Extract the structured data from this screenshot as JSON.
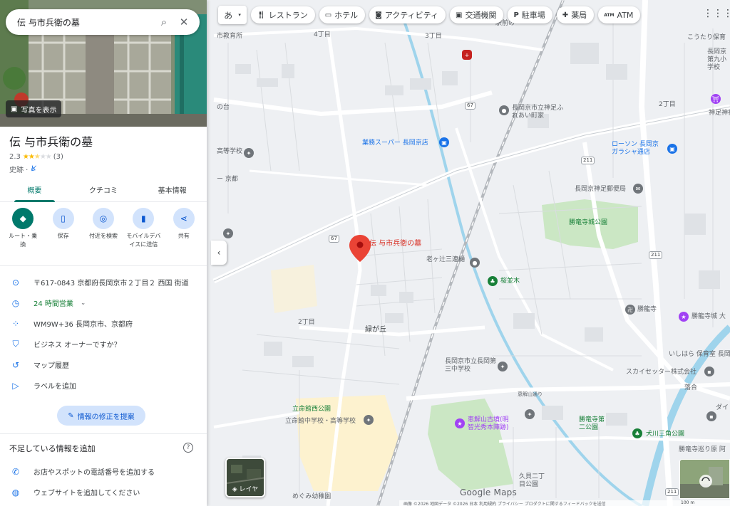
{
  "search": {
    "query": "伝 与市兵衛の墓"
  },
  "place": {
    "photo_button": "写真を表示",
    "title": "伝 与市兵衛の墓",
    "rating": "2.3",
    "review_count": "(3)",
    "category": "史跡 ·"
  },
  "tabs": [
    {
      "label": "概要"
    },
    {
      "label": "クチコミ"
    },
    {
      "label": "基本情報"
    }
  ],
  "actions": [
    {
      "label": "ルート・乗換",
      "icon": "directions-icon"
    },
    {
      "label": "保存",
      "icon": "bookmark-icon"
    },
    {
      "label": "付近を検索",
      "icon": "nearby-icon"
    },
    {
      "label": "モバイルデバイスに送信",
      "icon": "send-to-phone-icon"
    },
    {
      "label": "共有",
      "icon": "share-icon"
    }
  ],
  "info": {
    "address": "〒617-0843 京都府長岡京市２丁目２ 西国 街道",
    "hours": "24 時間営業",
    "plus_code": "WM9W+36 長岡京市、京都府",
    "owner": "ビジネス オーナーですか？",
    "history": "マップ履歴",
    "label": "ラベルを追加"
  },
  "suggest_edit": "情報の修正を提案",
  "missing": {
    "title": "不足している情報を追加",
    "items": [
      "お店やスポットの電話番号を追加する",
      "ウェブサイトを追加してください"
    ]
  },
  "top_bar": {
    "lang": "あ",
    "chips": [
      {
        "label": "レストラン",
        "icon": "restaurant-icon"
      },
      {
        "label": "ホテル",
        "icon": "hotel-icon"
      },
      {
        "label": "アクティビティ",
        "icon": "camera-icon"
      },
      {
        "label": "交通機関",
        "icon": "transit-icon"
      },
      {
        "label": "駐車場",
        "icon": "parking-icon"
      },
      {
        "label": "薬局",
        "icon": "pharmacy-icon"
      },
      {
        "label": "ATM",
        "icon": "atm-icon"
      }
    ]
  },
  "map": {
    "pin_label": "伝 与市兵衛の墓",
    "labels": {
      "kyoiku": "市教育所",
      "chome4": "4丁目",
      "chome3": "3丁目",
      "ekimae": "駅前の",
      "daiichi": "の台",
      "kotogakko": "高等学校",
      "kyoto": "ー 京都",
      "shintei": "長岡京市立神足ふれあい町家",
      "gyomu": "業務スーパー 長岡京店",
      "lawson": "ローソン 長岡京ガラシャ通店",
      "kotari": "こうたり保育",
      "nagaokakyo": "長岡京第九小学校",
      "chome2a": "2丁目",
      "kotari_jinja": "神足神社",
      "yubin": "長岡京神足郵便局",
      "shoryuji_park": "勝竜寺城公園",
      "oigatsuji": "老ヶ辻三連樋",
      "sakuranamiki": "桜並木",
      "shoryuji": "勝龍寺",
      "shoryuji_castle": "勝龍寺城 大",
      "chome2b": "2丁目",
      "midorigaoka": "緑が丘",
      "dai3": "長岡京市立長岡第三中学校",
      "ishihara": "いしはら 保育室 長岡",
      "skysetter": "スカイセッター株式会社",
      "ochiai": "落合",
      "egeyama_st": "恵解山通り",
      "ritsumei_park": "立命館西公園",
      "ritsumei_school": "立命館中学校・高等学校",
      "egeyama_kofun": "恵解山古墳(明智光秀本陣跡)",
      "shoryuji_park2": "勝竜寺第二公園",
      "inugawa": "犬川三角公園",
      "kuguni": "久貝二丁目公園",
      "meguminoyama": "めぐみ幼稚園",
      "shoryuji_dori": "勝竜寺巡り原 阿",
      "daiya": "ダイ"
    },
    "routes": [
      "67",
      "67",
      "211",
      "211",
      "211"
    ],
    "layers_label": "レイヤ",
    "google_logo": "Google Maps",
    "footer": "画像 ©2026   地図データ ©2026   日本   利用規約   プライバシー   プロダクトに関するフィードバックを送信",
    "scale": "100 m"
  }
}
